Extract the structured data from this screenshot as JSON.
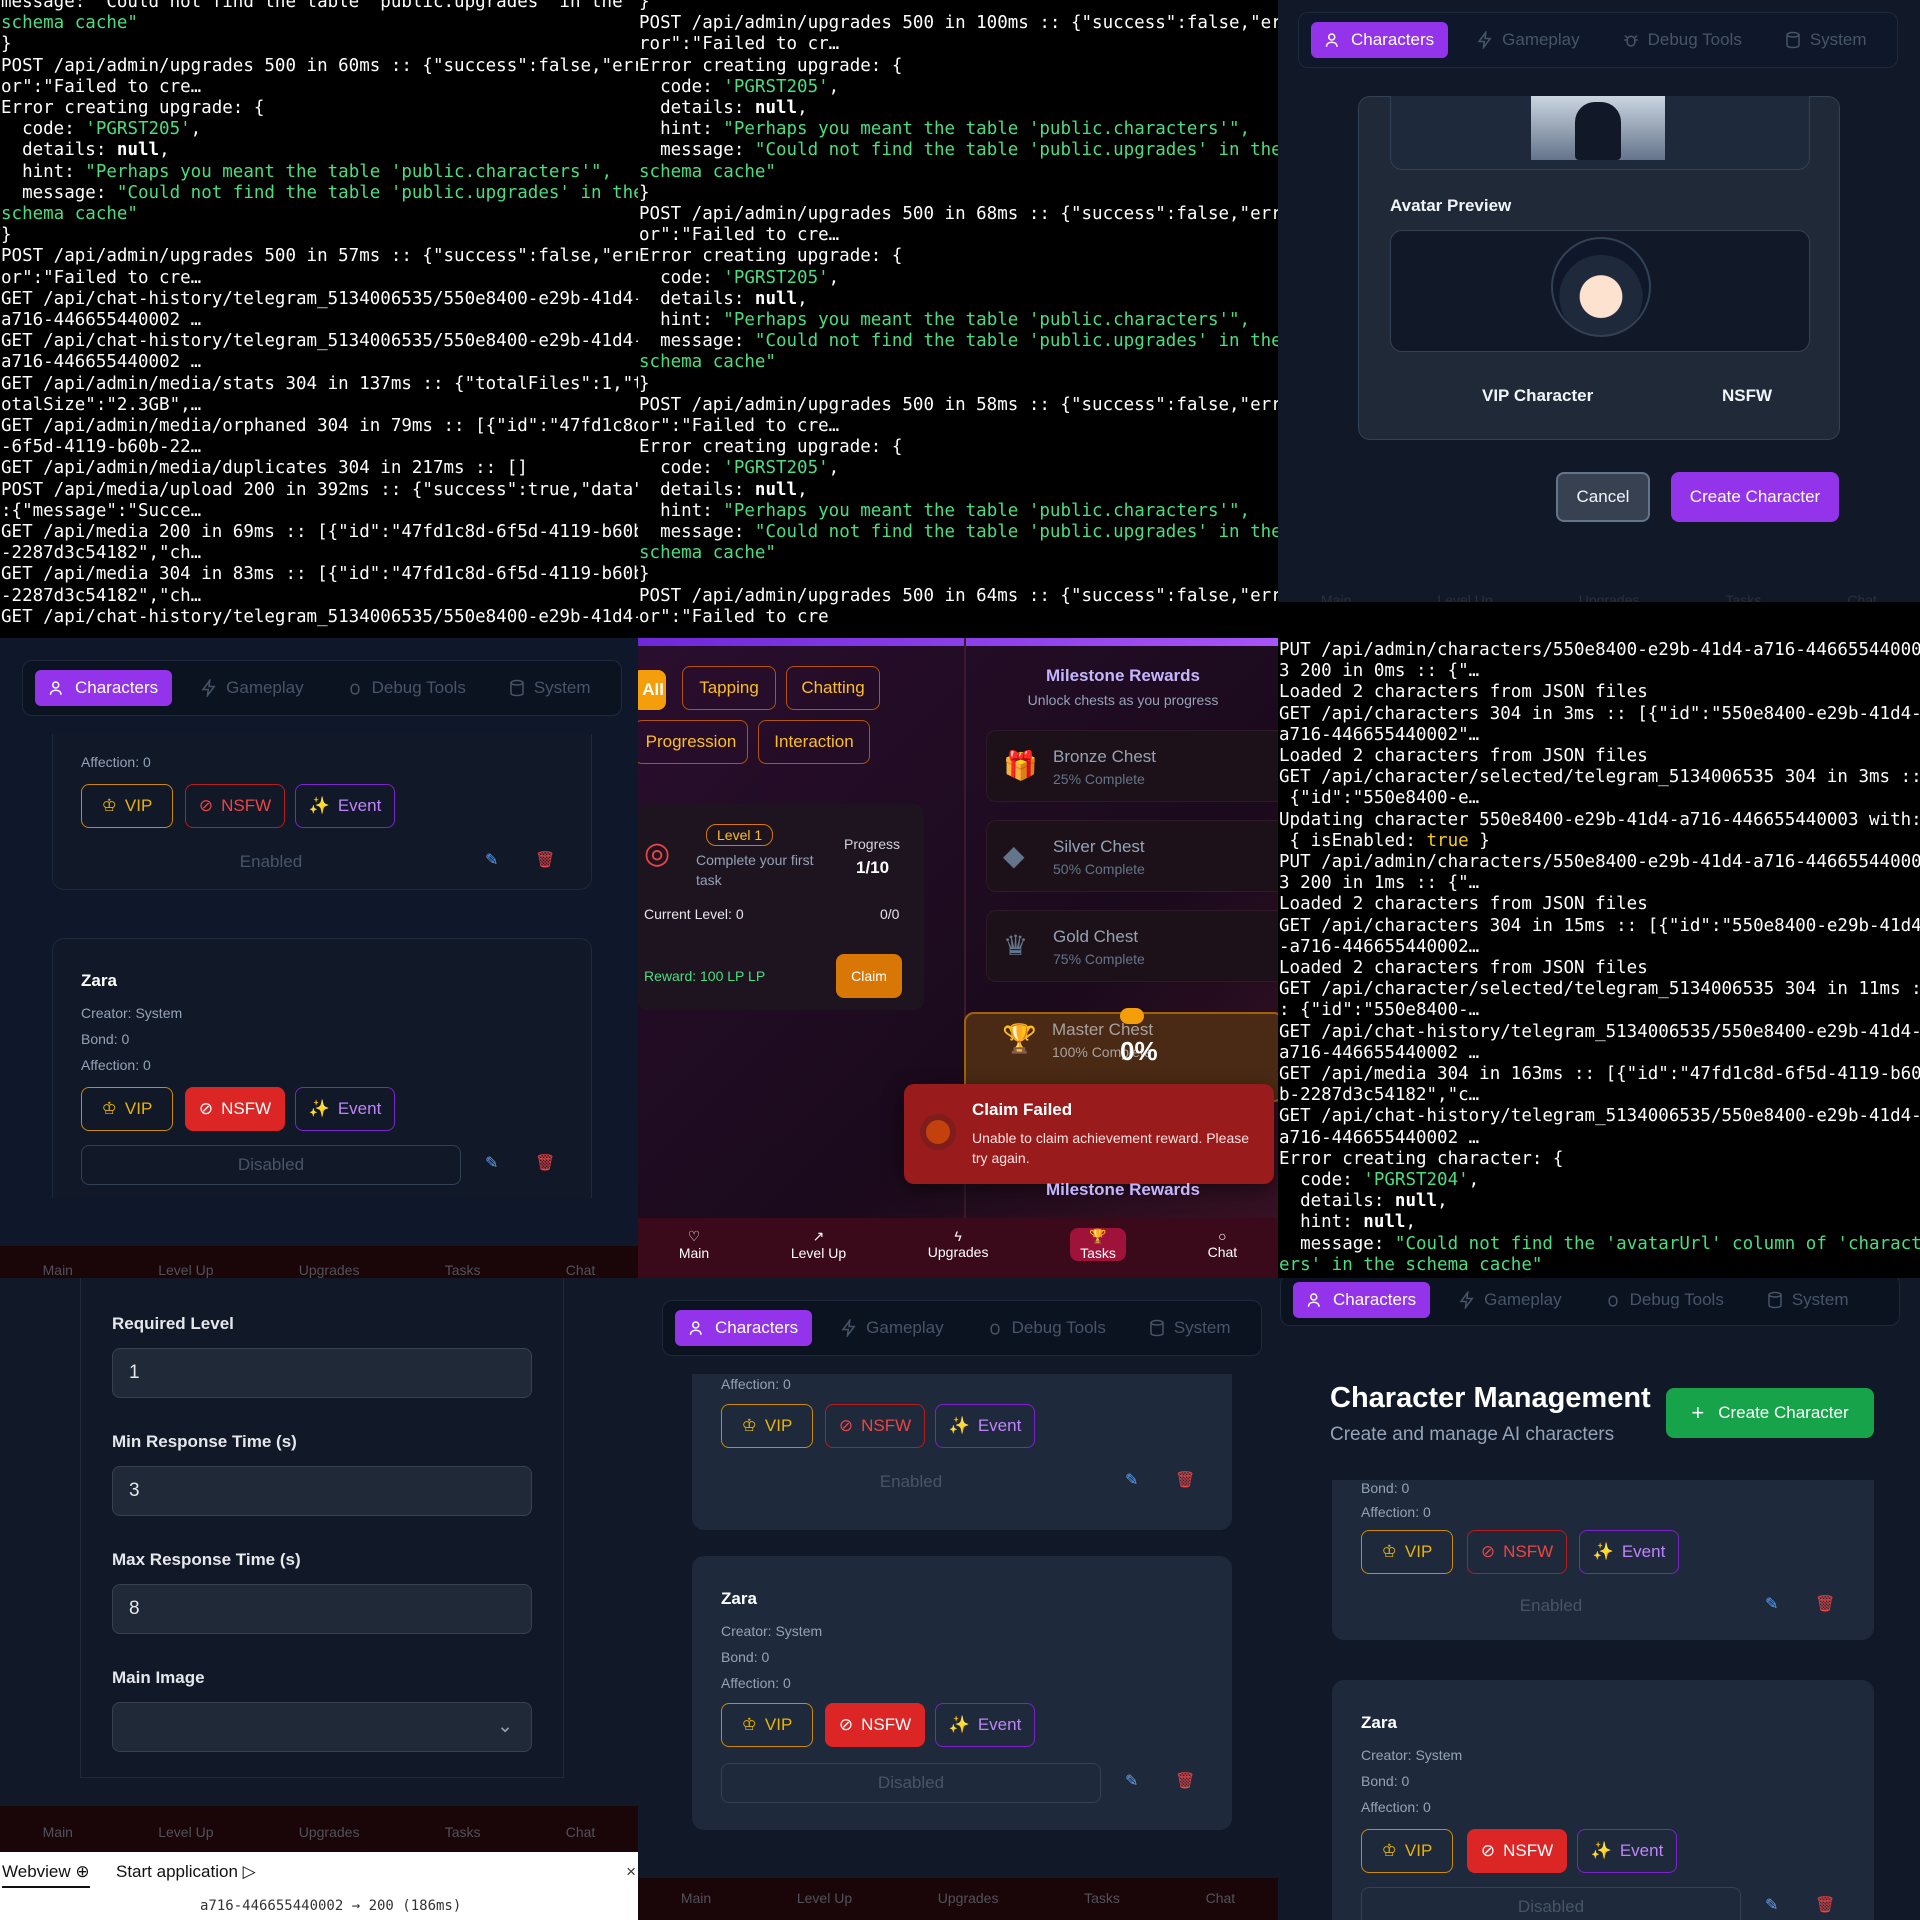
{
  "log1": {
    "lines": [
      "message: \"Could not find the table 'public.upgrades' in the",
      "schema cache\"",
      "}",
      "POST /api/admin/upgrades 500 in 60ms :: {\"success\":false,\"err",
      "or\":\"Failed to cre…",
      "Error creating upgrade: {",
      "  code: 'PGRST205',",
      "  details: null,",
      "  hint: \"Perhaps you meant the table 'public.characters'\",",
      "  message: \"Could not find the table 'public.upgrades' in the",
      "schema cache\"",
      "}",
      "POST /api/admin/upgrades 500 in 57ms :: {\"success\":false,\"err",
      "or\":\"Failed to cre…",
      "GET /api/chat-history/telegram_5134006535/550e8400-e29b-41d4-",
      "a716-446655440002 …",
      "GET /api/chat-history/telegram_5134006535/550e8400-e29b-41d4-",
      "a716-446655440002 …",
      "GET /api/admin/media/stats 304 in 137ms :: {\"totalFiles\":1,\"t",
      "otalSize\":\"2.3GB\",…",
      "GET /api/admin/media/orphaned 304 in 79ms :: [{\"id\":\"47fd1c8d",
      "-6f5d-4119-b60b-22…",
      "GET /api/admin/media/duplicates 304 in 217ms :: []",
      "POST /api/media/upload 200 in 392ms :: {\"success\":true,\"data\"",
      ":{\"message\":\"Succe…",
      "GET /api/media 200 in 69ms :: [{\"id\":\"47fd1c8d-6f5d-4119-b60b",
      "-2287d3c54182\",\"ch…",
      "GET /api/media 304 in 83ms :: [{\"id\":\"47fd1c8d-6f5d-4119-b60b",
      "-2287d3c54182\",\"ch…",
      "GET /api/chat-history/telegram_5134006535/550e8400-e29b-41d4-",
      "a716-446655440002 …"
    ]
  },
  "log2": {
    "lines": [
      "}",
      "POST /api/admin/upgrades 500 in 100ms :: {\"success\":false,\"er",
      "ror\":\"Failed to cr…",
      "Error creating upgrade: {",
      "  code: 'PGRST205',",
      "  details: null,",
      "  hint: \"Perhaps you meant the table 'public.characters'\",",
      "  message: \"Could not find the table 'public.upgrades' in the",
      "schema cache\"",
      "}",
      "POST /api/admin/upgrades 500 in 68ms :: {\"success\":false,\"err",
      "or\":\"Failed to cre…",
      "Error creating upgrade: {",
      "  code: 'PGRST205',",
      "  details: null,",
      "  hint: \"Perhaps you meant the table 'public.characters'\",",
      "  message: \"Could not find the table 'public.upgrades' in the",
      "schema cache\"",
      "}",
      "POST /api/admin/upgrades 500 in 58ms :: {\"success\":false,\"err",
      "or\":\"Failed to cre…",
      "Error creating upgrade: {",
      "  code: 'PGRST205',",
      "  details: null,",
      "  hint: \"Perhaps you meant the table 'public.characters'\",",
      "  message: \"Could not find the table 'public.upgrades' in the",
      "schema cache\"",
      "}",
      "POST /api/admin/upgrades 500 in 64ms :: {\"success\":false,\"err",
      "or\":\"Failed to cre"
    ]
  },
  "log3": {
    "lines": [
      "PUT /api/admin/characters/550e8400-e29b-41d4-a716-44665544000",
      "3 200 in 0ms :: {\"…",
      "Loaded 2 characters from JSON files",
      "GET /api/characters 304 in 3ms :: [{\"id\":\"550e8400-e29b-41d4-",
      "a716-446655440002\"…",
      "Loaded 2 characters from JSON files",
      "GET /api/character/selected/telegram_5134006535 304 in 3ms ::",
      " {\"id\":\"550e8400-e…",
      "Updating character 550e8400-e29b-41d4-a716-446655440003 with:",
      " { isEnabled: true }",
      "PUT /api/admin/characters/550e8400-e29b-41d4-a716-44665544000",
      "3 200 in 1ms :: {\"…",
      "Loaded 2 characters from JSON files",
      "GET /api/characters 304 in 15ms :: [{\"id\":\"550e8400-e29b-41d4",
      "-a716-446655440002…",
      "Loaded 2 characters from JSON files",
      "GET /api/character/selected/telegram_5134006535 304 in 11ms :",
      ": {\"id\":\"550e8400-…",
      "GET /api/chat-history/telegram_5134006535/550e8400-e29b-41d4-",
      "a716-446655440002 …",
      "GET /api/media 304 in 163ms :: [{\"id\":\"47fd1c8d-6f5d-4119-b60",
      "b-2287d3c54182\",\"c…",
      "GET /api/chat-history/telegram_5134006535/550e8400-e29b-41d4-",
      "a716-446655440002 …",
      "Error creating character: {",
      "  code: 'PGRST204',",
      "  details: null,",
      "  hint: null,",
      "  message: \"Could not find the 'avatarUrl' column of 'charact",
      "ers' in the schema cache\""
    ]
  },
  "tabs": {
    "characters": "Characters",
    "gameplay": "Gameplay",
    "debug": "Debug Tools",
    "system": "System"
  },
  "nav": {
    "main": "Main",
    "levelup": "Level Up",
    "upgrades": "Upgrades",
    "tasks": "Tasks",
    "chat": "Chat"
  },
  "create_form": {
    "avatar_preview": "Avatar Preview",
    "vip": "VIP Character",
    "nsfw": "NSFW",
    "cancel": "Cancel",
    "create": "Create Character"
  },
  "char_cards": {
    "bond": "Bond: 0",
    "affection": "Affection: 0",
    "creator": "Creator: System",
    "name": "Zara",
    "vip": "VIP",
    "nsfw": "NSFW",
    "event": "Event",
    "enabled": "Enabled",
    "disabled": "Disabled"
  },
  "tasks_screen": {
    "filters": [
      "All",
      "Tapping",
      "Chatting",
      "Progression",
      "Interaction"
    ],
    "milestone_title": "Milestone Rewards",
    "milestone_sub": "Unlock chests as you progress",
    "chests": [
      {
        "name": "Bronze Chest",
        "pct": "25% Complete"
      },
      {
        "name": "Silver Chest",
        "pct": "50% Complete"
      },
      {
        "name": "Gold Chest",
        "pct": "75% Complete"
      },
      {
        "name": "Master Chest",
        "pct": "100% Complete"
      }
    ],
    "level_badge": "Level 1",
    "task_desc": "Complete your first task",
    "progress_label": "Progress",
    "progress_value": "1/10",
    "current_level": "Current Level: 0",
    "current_ratio": "0/0",
    "reward": "Reward: 100 LP LP",
    "claim": "Claim",
    "overlay_pct": "0%",
    "toast_title": "Claim Failed",
    "toast_body": "Unable to claim achievement reward. Please try again."
  },
  "settings_form": {
    "required_level": "Required Level",
    "required_level_val": "1",
    "min_resp": "Min Response Time (s)",
    "min_resp_val": "3",
    "max_resp": "Max Response Time (s)",
    "max_resp_val": "8",
    "main_image": "Main Image"
  },
  "ide_bar": {
    "webview": "Webview",
    "start": "Start application",
    "log_tail": "a716-446655440002 → 200 (186ms)"
  },
  "management": {
    "title": "Character Management",
    "subtitle": "Create and manage AI characters",
    "create": "Create Character"
  }
}
